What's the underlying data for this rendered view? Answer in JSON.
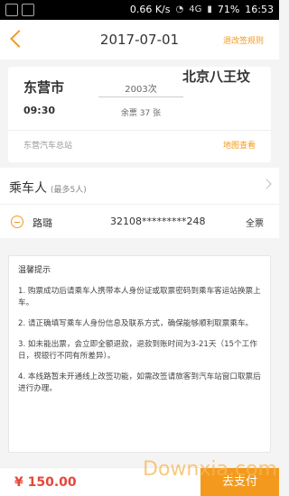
{
  "status": {
    "speed": "0.66 K/s",
    "battery": "71%",
    "time": "16:53",
    "net": "4G"
  },
  "header": {
    "title": "2017-07-01",
    "rule_link": "退改签规则"
  },
  "trip": {
    "from_city": "东营市",
    "from_time": "09:30",
    "train": "2003次",
    "remaining": "余票 37 张",
    "to_city": "北京八王坟",
    "station": "东营汽车总站",
    "map_link": "地图查看"
  },
  "passengers": {
    "title": "乘车人",
    "subtitle": "(最多5人)",
    "items": [
      {
        "name": "路璐",
        "id": "32108*********248",
        "type": "全票"
      }
    ]
  },
  "tips": {
    "title": "温馨提示",
    "items": [
      "1. 购票成功后请乘车人携带本人身份证或取票密码到乘车客运站换票上车。",
      "2. 请正确填写乘车人身份信息及联系方式，确保能够顺利取票乘车。",
      "3. 如未能出票，会立即全额退款，退款到账时间为3-21天（15个工作日，视银行不同有所差异）。",
      "4. 本线路暂未开通线上改签功能，如需改签请旅客到汽车站窗口取票后进行办理。"
    ]
  },
  "bottom": {
    "price": "¥ 150.00",
    "pay_label": "去支付"
  },
  "watermark": "Downxia.com"
}
